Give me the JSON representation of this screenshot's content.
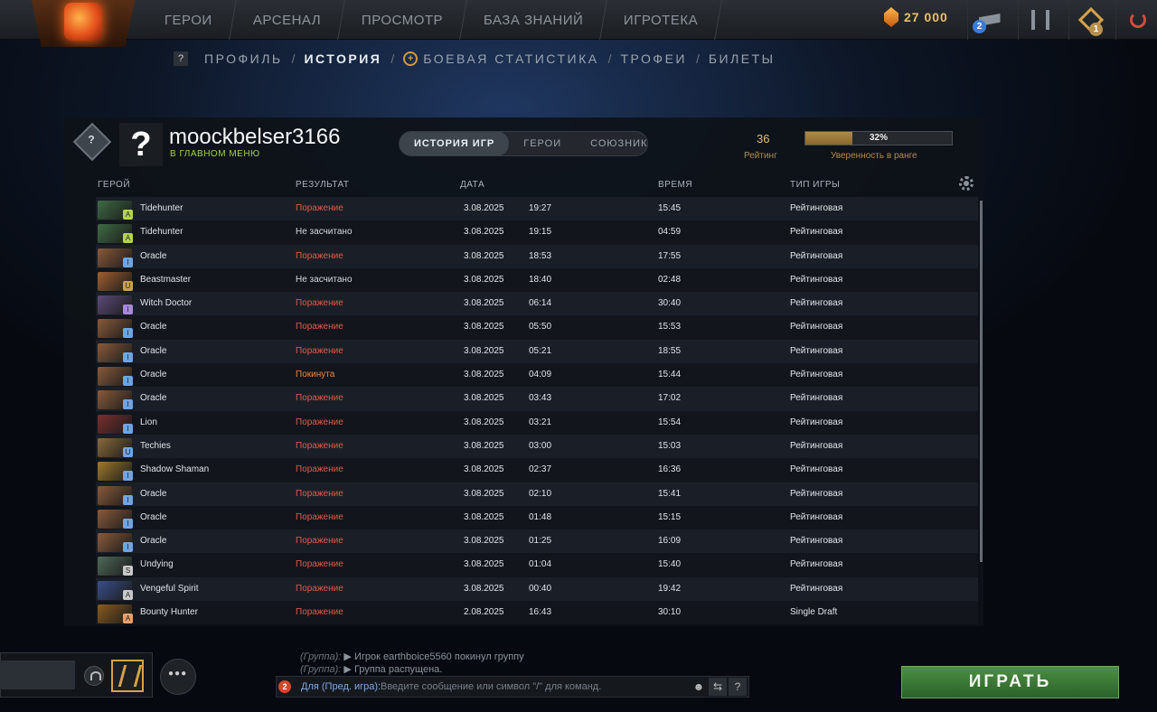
{
  "top_nav": [
    "ГЕРОИ",
    "АРСЕНАЛ",
    "ПРОСМОТР",
    "БАЗА ЗНАНИЙ",
    "ИГРОТЕКА"
  ],
  "currency": "27 000",
  "badges": {
    "notifications": "2",
    "plus": "1"
  },
  "subnav": {
    "profile": "ПРОФИЛЬ",
    "history": "ИСТОРИЯ",
    "stats": "БОЕВАЯ СТАТИСТИКА",
    "trophies": "ТРОФЕИ",
    "tickets": "БИЛЕТЫ",
    "sep": "/"
  },
  "profile": {
    "rank_badge": "?",
    "avatar": "?",
    "username": "moockbelser3166",
    "status": "В ГЛАВНОМ МЕНЮ",
    "tabs": [
      "ИСТОРИЯ ИГР",
      "ГЕРОИ",
      "СОЮЗНИКИ"
    ],
    "rating_value": "36",
    "rating_label": "Рейтинг",
    "confidence_percent": 32,
    "confidence_text": "32%",
    "confidence_label": "Уверенность в ранге"
  },
  "columns": {
    "hero": "ГЕРОЙ",
    "result": "РЕЗУЛЬТАТ",
    "date": "ДАТА",
    "duration": "ВРЕМЯ",
    "type": "ТИП ИГРЫ"
  },
  "matches": [
    {
      "hero": "Tidehunter",
      "result": "Поражение",
      "status": "loss",
      "date": "3.08.2025",
      "time": "19:27",
      "duration": "15:45",
      "type": "Рейтинговая",
      "hero_color": "#3e6b45",
      "role_color": "#b6d44a",
      "role": "A"
    },
    {
      "hero": "Tidehunter",
      "result": "Не засчитано",
      "status": "void",
      "date": "3.08.2025",
      "time": "19:15",
      "duration": "04:59",
      "type": "Рейтинговая",
      "hero_color": "#3e6b45",
      "role_color": "#b6d44a",
      "role": "A"
    },
    {
      "hero": "Oracle",
      "result": "Поражение",
      "status": "loss",
      "date": "3.08.2025",
      "time": "18:53",
      "duration": "17:55",
      "type": "Рейтинговая",
      "hero_color": "#8a5a3a",
      "role_color": "#6fa4e6",
      "role": "I"
    },
    {
      "hero": "Beastmaster",
      "result": "Не засчитано",
      "status": "void",
      "date": "3.08.2025",
      "time": "18:40",
      "duration": "02:48",
      "type": "Рейтинговая",
      "hero_color": "#a05e2e",
      "role_color": "#c9a24a",
      "role": "U"
    },
    {
      "hero": "Witch Doctor",
      "result": "Поражение",
      "status": "loss",
      "date": "3.08.2025",
      "time": "06:14",
      "duration": "30:40",
      "type": "Рейтинговая",
      "hero_color": "#5b4a7a",
      "role_color": "#a888d8",
      "role": "I"
    },
    {
      "hero": "Oracle",
      "result": "Поражение",
      "status": "loss",
      "date": "3.08.2025",
      "time": "05:50",
      "duration": "15:53",
      "type": "Рейтинговая",
      "hero_color": "#8a5a3a",
      "role_color": "#6fa4e6",
      "role": "I"
    },
    {
      "hero": "Oracle",
      "result": "Поражение",
      "status": "loss",
      "date": "3.08.2025",
      "time": "05:21",
      "duration": "18:55",
      "type": "Рейтинговая",
      "hero_color": "#8a5a3a",
      "role_color": "#6fa4e6",
      "role": "I"
    },
    {
      "hero": "Oracle",
      "result": "Покинута",
      "status": "abandon",
      "date": "3.08.2025",
      "time": "04:09",
      "duration": "15:44",
      "type": "Рейтинговая",
      "hero_color": "#8a5a3a",
      "role_color": "#6fa4e6",
      "role": "I"
    },
    {
      "hero": "Oracle",
      "result": "Поражение",
      "status": "loss",
      "date": "3.08.2025",
      "time": "03:43",
      "duration": "17:02",
      "type": "Рейтинговая",
      "hero_color": "#8a5a3a",
      "role_color": "#6fa4e6",
      "role": "I"
    },
    {
      "hero": "Lion",
      "result": "Поражение",
      "status": "loss",
      "date": "3.08.2025",
      "time": "03:21",
      "duration": "15:54",
      "type": "Рейтинговая",
      "hero_color": "#7a2e2e",
      "role_color": "#6fa4e6",
      "role": "I"
    },
    {
      "hero": "Techies",
      "result": "Поражение",
      "status": "loss",
      "date": "3.08.2025",
      "time": "03:00",
      "duration": "15:03",
      "type": "Рейтинговая",
      "hero_color": "#8a6a3a",
      "role_color": "#6fa4e6",
      "role": "U"
    },
    {
      "hero": "Shadow Shaman",
      "result": "Поражение",
      "status": "loss",
      "date": "3.08.2025",
      "time": "02:37",
      "duration": "16:36",
      "type": "Рейтинговая",
      "hero_color": "#a07a2a",
      "role_color": "#6fa4e6",
      "role": "I"
    },
    {
      "hero": "Oracle",
      "result": "Поражение",
      "status": "loss",
      "date": "3.08.2025",
      "time": "02:10",
      "duration": "15:41",
      "type": "Рейтинговая",
      "hero_color": "#8a5a3a",
      "role_color": "#6fa4e6",
      "role": "I"
    },
    {
      "hero": "Oracle",
      "result": "Поражение",
      "status": "loss",
      "date": "3.08.2025",
      "time": "01:48",
      "duration": "15:15",
      "type": "Рейтинговая",
      "hero_color": "#8a5a3a",
      "role_color": "#6fa4e6",
      "role": "I"
    },
    {
      "hero": "Oracle",
      "result": "Поражение",
      "status": "loss",
      "date": "3.08.2025",
      "time": "01:25",
      "duration": "16:09",
      "type": "Рейтинговая",
      "hero_color": "#8a5a3a",
      "role_color": "#6fa4e6",
      "role": "I"
    },
    {
      "hero": "Undying",
      "result": "Поражение",
      "status": "loss",
      "date": "3.08.2025",
      "time": "01:04",
      "duration": "15:40",
      "type": "Рейтинговая",
      "hero_color": "#4f6a5a",
      "role_color": "#c9c9c9",
      "role": "S"
    },
    {
      "hero": "Vengeful Spirit",
      "result": "Поражение",
      "status": "loss",
      "date": "3.08.2025",
      "time": "00:40",
      "duration": "19:42",
      "type": "Рейтинговая",
      "hero_color": "#3a4f8a",
      "role_color": "#c9c9c9",
      "role": "A"
    },
    {
      "hero": "Bounty Hunter",
      "result": "Поражение",
      "status": "loss",
      "date": "2.08.2025",
      "time": "16:43",
      "duration": "30:10",
      "type": "Single Draft",
      "hero_color": "#8a5a20",
      "role_color": "#e6a06f",
      "role": "A"
    }
  ],
  "chat": {
    "line1_prefix": "(Группа):",
    "line1_text": "▶ Игрок earthboice5560 покинул группу",
    "line2_prefix": "(Группа):",
    "line2_text": "▶ Группа распущена.",
    "unread": "2",
    "channel": "Для (Пред. игра):",
    "placeholder": "Введите сообщение или символ \"/\" для команд.",
    "help": "?"
  },
  "play_button": "ИГРАТЬ"
}
